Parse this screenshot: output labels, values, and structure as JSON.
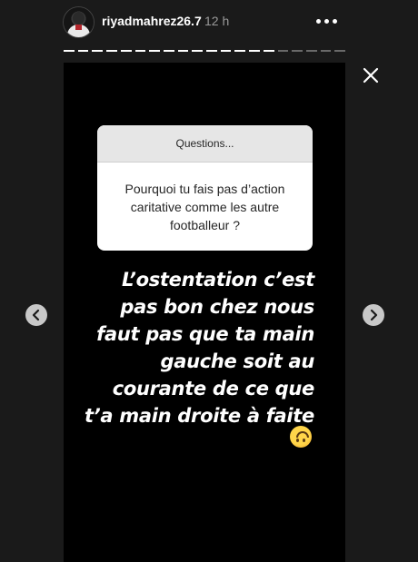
{
  "header": {
    "username": "riyadmahrez26.7",
    "timestamp": "12 h",
    "avatar_icon": "profile-avatar",
    "more_icon": "more-horizontal-icon"
  },
  "progress": {
    "segments_total": 20,
    "segments_viewed": 15
  },
  "close_icon": "close-icon",
  "story": {
    "question_sticker": {
      "title": "Questions...",
      "question": "Pourquoi tu fais pas d’action caritative comme les autre footballeur ?"
    },
    "answer": "L’ostentation c’est\npas bon chez nous\nfaut pas que ta main\ngauche soit au\ncourante de ce que\nt’a main droite à faite",
    "emoji": "upside-down-face",
    "background_color": "#000000"
  },
  "navigation": {
    "previous_icon": "chevron-left-icon",
    "next_icon": "chevron-right-icon"
  },
  "colors": {
    "page_background": "#1a1a1a",
    "nav_button": "#c8c8c8",
    "timestamp_text": "#9a9a9a"
  }
}
